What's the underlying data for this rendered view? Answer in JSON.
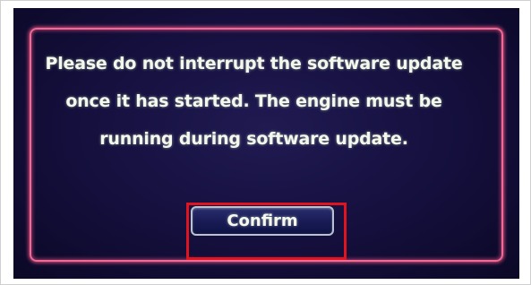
{
  "dialog": {
    "message": "Please do not interrupt the software update once it has started. The engine must be running during software update.",
    "confirm_label": "Confirm"
  },
  "colors": {
    "screen_background": "#140f3c",
    "dialog_border": "#f06a95",
    "text": "#f4f7ec",
    "highlight": "#e0141e"
  }
}
